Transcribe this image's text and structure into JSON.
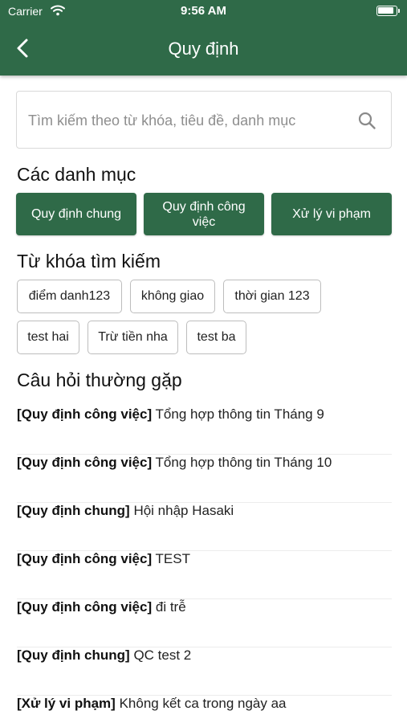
{
  "status_bar": {
    "carrier": "Carrier",
    "time": "9:56 AM"
  },
  "header": {
    "title": "Quy định",
    "back_icon": "chevron-left-icon"
  },
  "search": {
    "placeholder": "Tìm kiếm theo từ khóa, tiêu đề, danh mục",
    "icon": "search-icon"
  },
  "categories": {
    "title": "Các danh mục",
    "items": [
      {
        "label": "Quy định chung"
      },
      {
        "label": "Quy định công việc"
      },
      {
        "label": "Xử lý vi phạm"
      }
    ]
  },
  "keywords": {
    "title": "Từ khóa tìm kiếm",
    "items": [
      {
        "label": "điểm danh123"
      },
      {
        "label": "không giao"
      },
      {
        "label": "thời gian 123"
      },
      {
        "label": "test hai"
      },
      {
        "label": "Trừ tiền nha"
      },
      {
        "label": "test ba"
      }
    ]
  },
  "faq": {
    "title": "Câu hỏi thường gặp",
    "items": [
      {
        "category": "[Quy định công việc]",
        "text": "Tổng hợp thông tin Tháng 9"
      },
      {
        "category": "[Quy định công việc]",
        "text": "Tổng hợp thông tin Tháng 10"
      },
      {
        "category": "[Quy định chung]",
        "text": "Hội nhập Hasaki"
      },
      {
        "category": "[Quy định công việc]",
        "text": "TEST"
      },
      {
        "category": "[Quy định công việc]",
        "text": "đi trễ"
      },
      {
        "category": "[Quy định chung]",
        "text": "QC test 2"
      },
      {
        "category": "[Xử lý vi phạm]",
        "text": "Không kết ca trong ngày aa"
      }
    ]
  },
  "colors": {
    "brand_green": "#2f6a48"
  }
}
